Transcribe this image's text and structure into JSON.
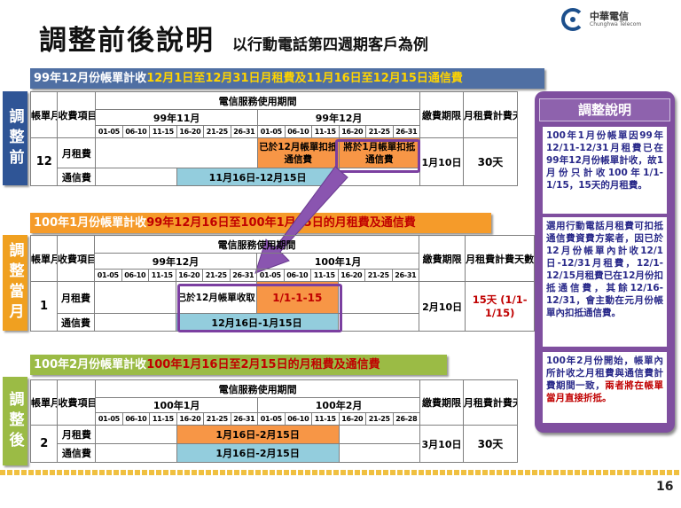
{
  "title": {
    "main": "調整前後說明",
    "sub": "以行動電話第四週期客戶為例"
  },
  "logo": {
    "name": "中華電信",
    "sub": "Chunghwa Telecom"
  },
  "banners": {
    "b1": {
      "p1": "99年12月份帳單計收",
      "p2": "12月1日至12月31日月租費及11月16日至12月15日通信費"
    },
    "b2": {
      "p1": "100年1月份帳單計收",
      "p2": "99年12月16日至100年1月15日的月租費及通信費"
    },
    "b3": {
      "p1": "100年2月份帳單計收",
      "p2": "100年1月16日至2月15日的月租費及通信費"
    }
  },
  "side_labels": {
    "before": "調整前",
    "current": "調整當月",
    "after": "調整後"
  },
  "table_common": {
    "bill_month": "帳單月份",
    "item": "收費項目",
    "period": "電信服務使用期間",
    "due": "繳費期限",
    "days": "月租費計費天數",
    "monthly": "月租費",
    "comm": "通信費"
  },
  "days_ranges": [
    "01-05",
    "06-10",
    "11-15",
    "16-20",
    "21-25",
    "26-31"
  ],
  "days_ranges_feb": [
    "01-05",
    "06-10",
    "11-15",
    "16-20",
    "21-25",
    "26-28"
  ],
  "t1": {
    "month_a": "99年11月",
    "month_b": "99年12月",
    "bill": "12",
    "monthly_left": "已於12月帳單扣抵通信費",
    "monthly_right": "將於1月帳單扣抵通信費",
    "comm": "11月16日-12月15日",
    "due": "1月10日",
    "days": "30天"
  },
  "t2": {
    "month_a": "99年12月",
    "month_b": "100年1月",
    "bill": "1",
    "monthly_left": "已於12月帳單收取",
    "monthly_right": "1/1-1-15",
    "comm": "12月16日-1月15日",
    "due": "2月10日",
    "days": "15天 (1/1-1/15)"
  },
  "t3": {
    "month_a": "100年1月",
    "month_b": "100年2月",
    "bill": "2",
    "monthly": "1月16日-2月15日",
    "comm": "1月16日-2月15日",
    "due": "3月10日",
    "days": "30天"
  },
  "panel": {
    "title": "調整說明",
    "n1": "100年1月份帳單因99年12/11-12/31月租費已在99年12月份帳單計收，故1月份只計收100年1/1-1/15，15天的月租費。",
    "n2": "選用行動電話月租費可扣抵通信費資費方案者，因已於12月份帳單內計收12/1日-12/31月租費，12/1-12/15月租費已在12月份扣抵通信費，其餘12/16-12/31，會主動在元月份帳單內扣抵通信費。",
    "n3a": "100年2月份開始，帳單內所計收之月租費與通信費計費期間一致，",
    "n3b": "兩者將在帳單當月直接折抵。"
  },
  "page_number": "16",
  "colors": {
    "purple": "#7f4f9f",
    "orange": "#f79646",
    "blue": "#93cddd",
    "red": "#c00000"
  }
}
